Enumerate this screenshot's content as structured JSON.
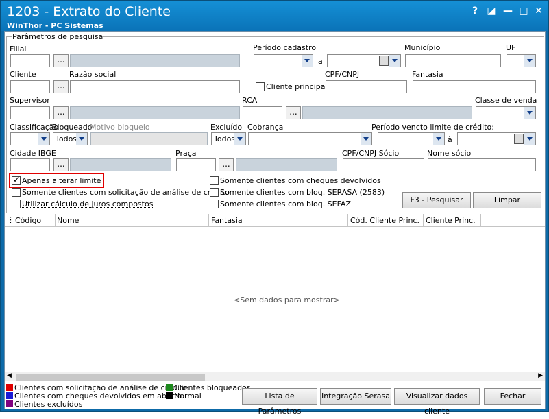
{
  "window": {
    "title": "1203 - Extrato do Cliente",
    "subtitle": "WinThor - PC Sistemas",
    "buttons": [
      "?",
      "◪",
      "—",
      "□",
      "✕"
    ]
  },
  "params": {
    "legend": "Parâmetros de pesquisa",
    "filial": "Filial",
    "periodo_cadastro": "Período cadastro",
    "a": "a",
    "municipio": "Município",
    "uf": "UF",
    "cliente": "Cliente",
    "razao_social": "Razão social",
    "cliente_principal": "Cliente principal",
    "cpf_cnpj": "CPF/CNPJ",
    "fantasia": "Fantasia",
    "supervisor": "Supervisor",
    "rca": "RCA",
    "classe_venda": "Classe de venda",
    "classificacao": "Classificação",
    "bloqueado": "Bloqueado",
    "motivo_bloqueio": "Motivo bloqueio",
    "excluido": "Excluído",
    "cobranca": "Cobrança",
    "periodo_vencto": "Período vencto limite de crédito:",
    "a2": "à",
    "cidade_ibge": "Cidade IBGE",
    "praca": "Praça",
    "cpf_socio": "CPF/CNPJ Sócio",
    "nome_socio": "Nome sócio",
    "todos": "Todos",
    "ellipsis": "..."
  },
  "checks": {
    "apenas_alterar_limite": "Apenas alterar limite",
    "somente_solicitacao": "Somente clientes com solicitação de análise de crédito",
    "utilizar_juros": "Utilizar cálculo de juros compostos",
    "somente_cheques": "Somente clientes com cheques devolvidos",
    "somente_serasa": "Somente clientes com bloq. SERASA (2583)",
    "somente_sefaz": "Somente clientes com bloq. SEFAZ"
  },
  "actions": {
    "pesquisar": "F3 - Pesquisar",
    "limpar": "Limpar"
  },
  "grid": {
    "columns": [
      "Código",
      "Nome",
      "Fantasia",
      "Cód. Cliente Princ.",
      "Cliente Princ."
    ],
    "empty": "<Sem dados para mostrar>"
  },
  "legend": {
    "items": [
      {
        "label": "Clientes com solicitação de análise de crédito",
        "color": "#e00000"
      },
      {
        "label": "Clientes com cheques devolvidos em aberto",
        "color": "#1a1ad6"
      },
      {
        "label": "Clientes excluídos",
        "color": "#800080"
      },
      {
        "label": "Clientes bloqueados",
        "color": "#1e8a1e"
      },
      {
        "label": "Normal",
        "color": "#000000"
      }
    ]
  },
  "footer": {
    "lista": "Lista de Parâmetros",
    "integracao": "Integração Serasa",
    "visualizar": "Visualizar dados cliente",
    "fechar": "Fechar"
  }
}
